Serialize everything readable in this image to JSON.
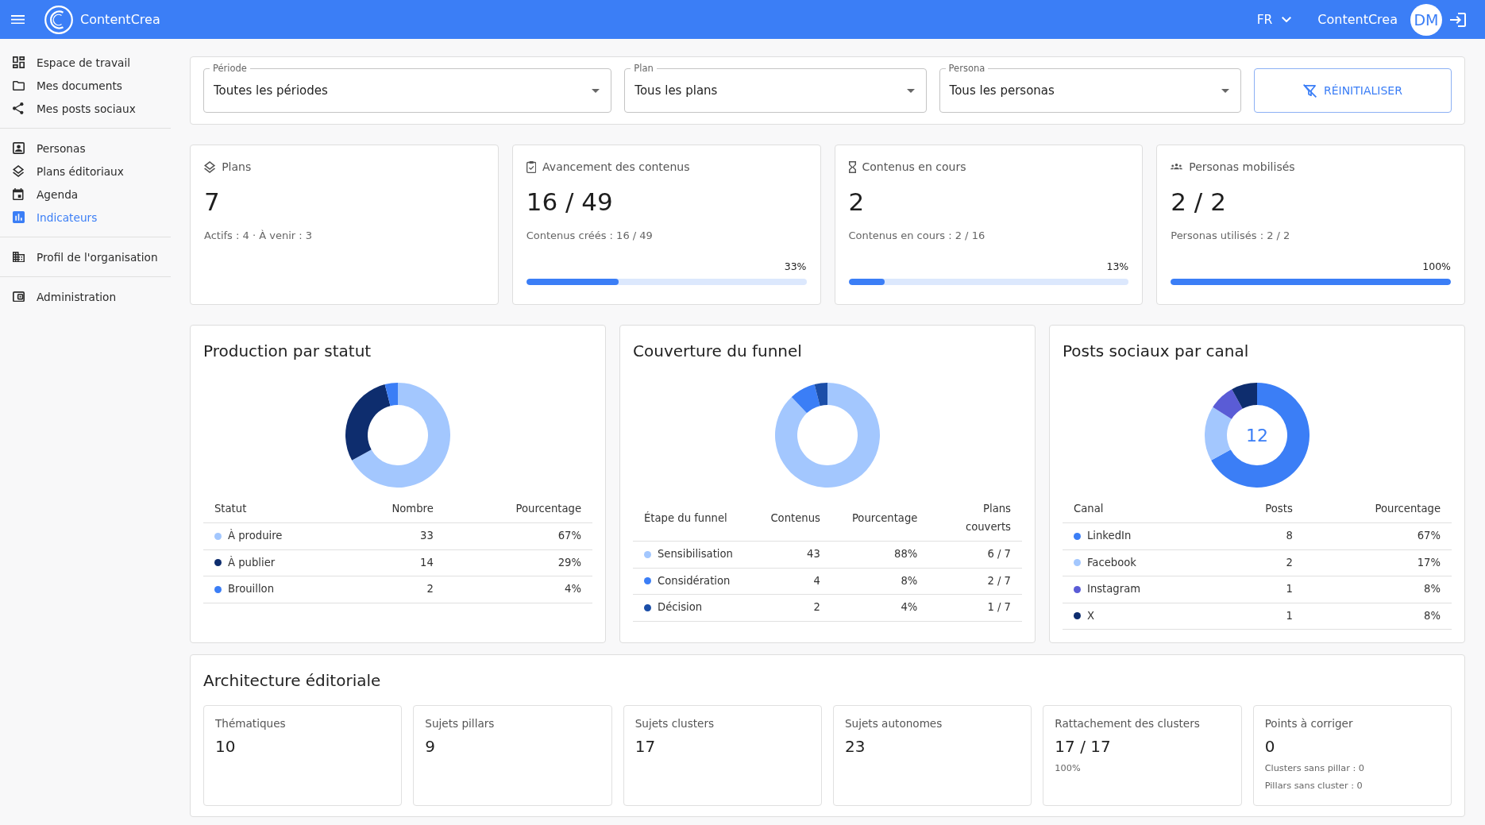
{
  "header": {
    "title": "ContentCrea",
    "language": "FR",
    "user_name": "ContentCrea",
    "avatar_initials": "DM"
  },
  "sidebar": {
    "groups": [
      {
        "items": [
          {
            "label": "Espace de travail",
            "selected": false
          },
          {
            "label": "Mes documents",
            "selected": false
          },
          {
            "label": "Mes posts sociaux",
            "selected": false
          }
        ]
      },
      {
        "items": [
          {
            "label": "Personas",
            "selected": false
          },
          {
            "label": "Plans éditoriaux",
            "selected": false
          },
          {
            "label": "Agenda",
            "selected": false
          },
          {
            "label": "Indicateurs",
            "selected": true
          }
        ]
      },
      {
        "items": [
          {
            "label": "Profil de l'organisation",
            "selected": false
          }
        ]
      },
      {
        "items": [
          {
            "label": "Administration",
            "selected": false
          }
        ]
      }
    ]
  },
  "filters": {
    "fields": [
      {
        "label": "Période",
        "value": "Toutes les périodes"
      },
      {
        "label": "Plan",
        "value": "Tous les plans"
      },
      {
        "label": "Persona",
        "value": "Tous les personas"
      }
    ],
    "reset_button": "RÉINITIALISER"
  },
  "kpi_cards": [
    {
      "title": "Plans",
      "value": "7",
      "detail": "Actifs : 4 · À venir : 3"
    },
    {
      "title": "Avancement des contenus",
      "value": "16 / 49",
      "detail": "Contenus créés : 16 / 49",
      "progress": {
        "reading": "33%",
        "level": 0.33
      }
    },
    {
      "title": "Contenus en cours",
      "value": "2",
      "detail": "Contenus en cours : 2 / 16",
      "progress": {
        "reading": "13%",
        "level": 0.13
      }
    },
    {
      "title": "Personas mobilisés",
      "value": "2 / 2",
      "detail": "Personas utilisés : 2 / 2",
      "progress": {
        "reading": "100%",
        "level": 1
      }
    }
  ],
  "chart_cards": [
    {
      "title": "Production par statut",
      "chart_data": {
        "type": "donut",
        "values": [
          67,
          29,
          4
        ]
      },
      "table": {
        "columns": [
          "Statut",
          "Nombre",
          "Pourcentage"
        ],
        "rows": [
          {
            "color": "#a3c7fe",
            "cells": [
              "À produire",
              "33",
              "67%"
            ]
          },
          {
            "color": "#0e2d6e",
            "cells": [
              "À publier",
              "14",
              "29%"
            ]
          },
          {
            "color": "#3b7ef6",
            "cells": [
              "Brouillon",
              "2",
              "4%"
            ]
          }
        ]
      }
    },
    {
      "title": "Couverture du funnel",
      "chart_data": {
        "type": "donut",
        "values": [
          88,
          8,
          4
        ]
      },
      "table": {
        "columns": [
          "Étape du funnel",
          "Contenus",
          "Pourcentage",
          "Plans couverts"
        ],
        "rows": [
          {
            "color": "#a3c7fe",
            "cells": [
              "Sensibilisation",
              "43",
              "88%",
              "6 / 7"
            ]
          },
          {
            "color": "#3b7ef6",
            "cells": [
              "Considération",
              "4",
              "8%",
              "2 / 7"
            ]
          },
          {
            "color": "#1b4ea8",
            "cells": [
              "Décision",
              "2",
              "4%",
              "1 / 7"
            ]
          }
        ]
      }
    },
    {
      "title": "Posts sociaux par canal",
      "center_label": "12",
      "chart_data": {
        "type": "donut",
        "values": [
          67,
          17,
          8,
          8
        ]
      },
      "table": {
        "columns": [
          "Canal",
          "Posts",
          "Pourcentage"
        ],
        "rows": [
          {
            "color": "#3b7ef6",
            "cells": [
              "LinkedIn",
              "8",
              "67%"
            ]
          },
          {
            "color": "#a3c7fe",
            "cells": [
              "Facebook",
              "2",
              "17%"
            ]
          },
          {
            "color": "#5a5cd6",
            "cells": [
              "Instagram",
              "1",
              "8%"
            ]
          },
          {
            "color": "#0e2d6e",
            "cells": [
              "X",
              "1",
              "8%"
            ]
          }
        ]
      }
    }
  ],
  "architecture": {
    "title": "Architecture éditoriale",
    "cards": [
      {
        "label": "Thématiques",
        "value": "10"
      },
      {
        "label": "Sujets pillars",
        "value": "9"
      },
      {
        "label": "Sujets clusters",
        "value": "17"
      },
      {
        "label": "Sujets autonomes",
        "value": "23"
      },
      {
        "label": "Rattachement des clusters",
        "value": "17 / 17",
        "notes": [
          "100%"
        ]
      },
      {
        "label": "Points à corriger",
        "value": "0",
        "notes": [
          "Clusters sans pillar : 0",
          "Pillars sans cluster : 0"
        ]
      }
    ]
  }
}
